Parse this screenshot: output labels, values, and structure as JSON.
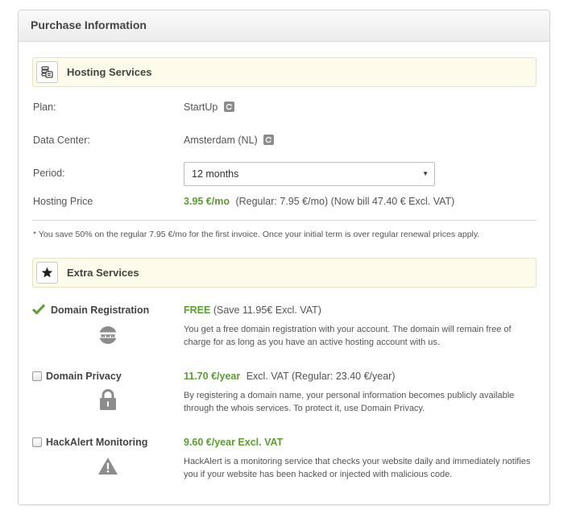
{
  "panel": {
    "title": "Purchase Information"
  },
  "hosting": {
    "section_title": "Hosting Services",
    "section_icon": "server-stack-icon",
    "plan": {
      "label": "Plan:",
      "value": "StartUp"
    },
    "datacenter": {
      "label": "Data Center:",
      "value": "Amsterdam (NL)"
    },
    "period": {
      "label": "Period:",
      "selected": "12 months"
    },
    "price": {
      "label": "Hosting Price",
      "amount": "3.95 €/mo",
      "details": "(Regular: 7.95 €/mo) (Now bill 47.40 € Excl. VAT)"
    },
    "note": "* You save 50% on the regular 7.95 €/mo for the first invoice. Once your initial term is over regular renewal prices apply."
  },
  "extra": {
    "section_title": "Extra Services",
    "section_icon": "star-icon",
    "services": [
      {
        "name": "Domain Registration",
        "price": "FREE",
        "price_suffix": "(Save 11.95€ Excl. VAT)",
        "description": "You get a free domain registration with your account. The domain will remain free of charge for as long as you have an active hosting account with us.",
        "icon": "www-globe-icon",
        "selected": true
      },
      {
        "name": "Domain Privacy",
        "price": "11.70 €/year",
        "price_suffix": "Excl. VAT (Regular: 23.40 €/year)",
        "description": "By registering a domain name, your personal information becomes publicly available through the whois services. To protect it, use Domain Privacy.",
        "icon": "padlock-icon",
        "selected": false
      },
      {
        "name": "HackAlert Monitoring",
        "price": "9.60 €/year Excl. VAT",
        "price_suffix": "",
        "description": "HackAlert is a monitoring service that checks your website daily and immediately notifies you if your website has been hacked or injected with malicious code.",
        "icon": "warning-triangle-icon",
        "selected": false
      }
    ]
  },
  "colors": {
    "accent_green": "#5a9e2f",
    "section_bg": "#fdfbe9",
    "icon_gray": "#8c8c8c"
  }
}
